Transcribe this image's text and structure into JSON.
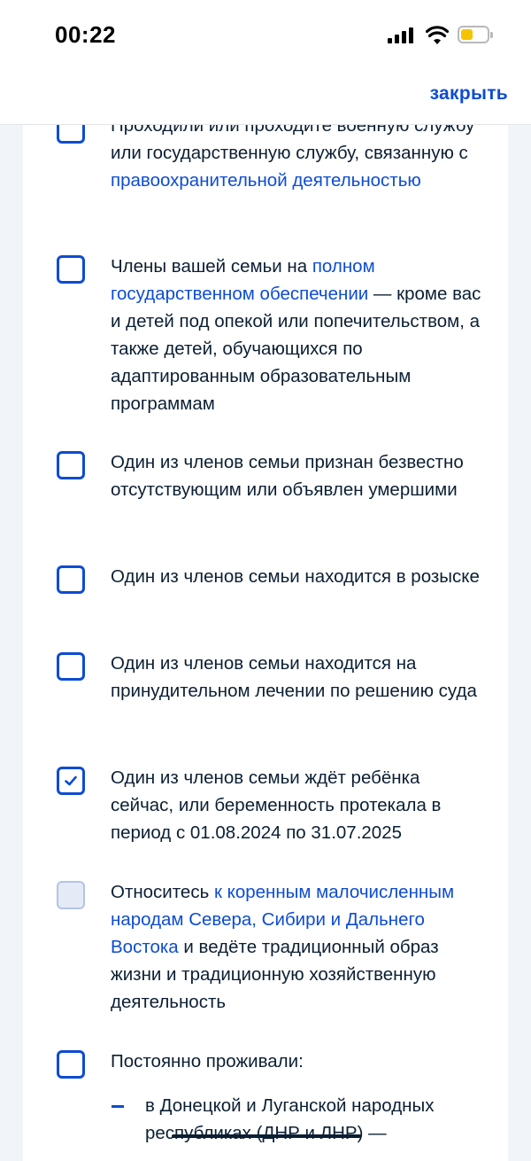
{
  "status_bar": {
    "time": "00:22"
  },
  "header": {
    "close_label": "закрыть"
  },
  "items": [
    {
      "state": "unchecked",
      "parts": [
        "Проходили или проходите военную службу или государственную службу, связанную с ",
        "правоохранительной деятельностью",
        ""
      ]
    },
    {
      "state": "unchecked",
      "parts": [
        "Члены вашей семьи на ",
        "полном государственном обеспечении",
        " — кроме вас и детей под опекой или попечительством, а также детей, обучающихся по адаптированным образовательным программам"
      ]
    },
    {
      "state": "unchecked",
      "text": "Один из членов семьи признан безвестно отсутствующим или объявлен умершими"
    },
    {
      "state": "unchecked",
      "text": "Один из членов семьи находится в розыске"
    },
    {
      "state": "unchecked",
      "text": "Один из членов семьи находится на принудительном лечении по решению суда"
    },
    {
      "state": "checked",
      "text": "Один из членов семьи ждёт ребёнка сейчас, или беременность протекала в период с 01.08.2024 по 31.07.2025"
    },
    {
      "state": "disabled",
      "parts": [
        "Относитесь ",
        "к коренным малочисленным народам Севера, Сибири и Дальнего Востока",
        " и ведёте традиционный образ жизни и традиционную хозяйственную деятельность"
      ]
    },
    {
      "state": "unchecked",
      "text": "Постоянно проживали:",
      "sub_item": "в Донецкой и Луганской народных республиках (ДНР и ЛНР) —"
    }
  ]
}
